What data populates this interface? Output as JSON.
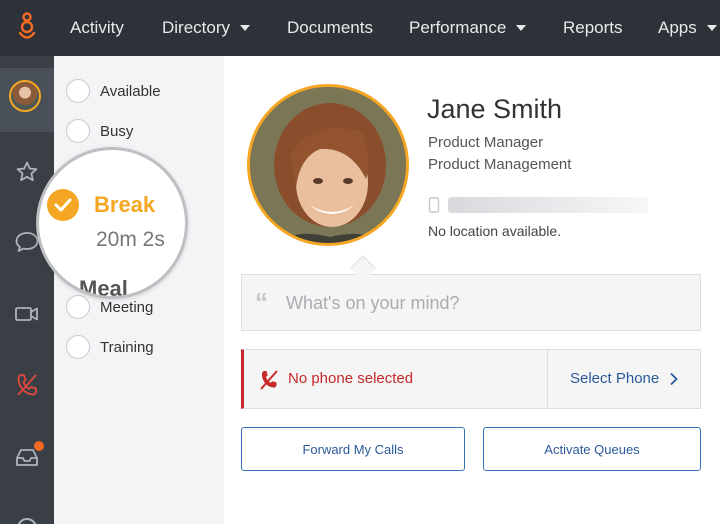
{
  "nav": {
    "items": [
      {
        "label": "Activity"
      },
      {
        "label": "Directory"
      },
      {
        "label": "Documents"
      },
      {
        "label": "Performance"
      },
      {
        "label": "Reports"
      },
      {
        "label": "Apps"
      }
    ]
  },
  "rail": {
    "icons": [
      "avatar",
      "star-icon",
      "chat-icon",
      "video-icon",
      "phone-off-icon",
      "inbox-icon"
    ],
    "inbox_badge": true
  },
  "status": {
    "options": [
      {
        "label": "Available"
      },
      {
        "label": "Busy"
      },
      {
        "label": "Meeting"
      },
      {
        "label": "Training"
      }
    ],
    "magnified": {
      "selected": "Break",
      "duration": "20m 2s",
      "partial_next": "Meal"
    }
  },
  "profile": {
    "name": "Jane Smith",
    "title": "Product Manager",
    "department": "Product Management",
    "location": "No location available."
  },
  "mind": {
    "placeholder": "What's on your mind?"
  },
  "phone": {
    "status": "No phone selected",
    "select_label": "Select Phone"
  },
  "buttons": {
    "forward": "Forward My Calls",
    "activate": "Activate Queues"
  },
  "colors": {
    "accent": "#f5a623",
    "topbar": "#2e3238",
    "rail": "#3a3f46",
    "error": "#c62a2a",
    "link": "#2b5a9a",
    "badge": "#f26b21"
  }
}
